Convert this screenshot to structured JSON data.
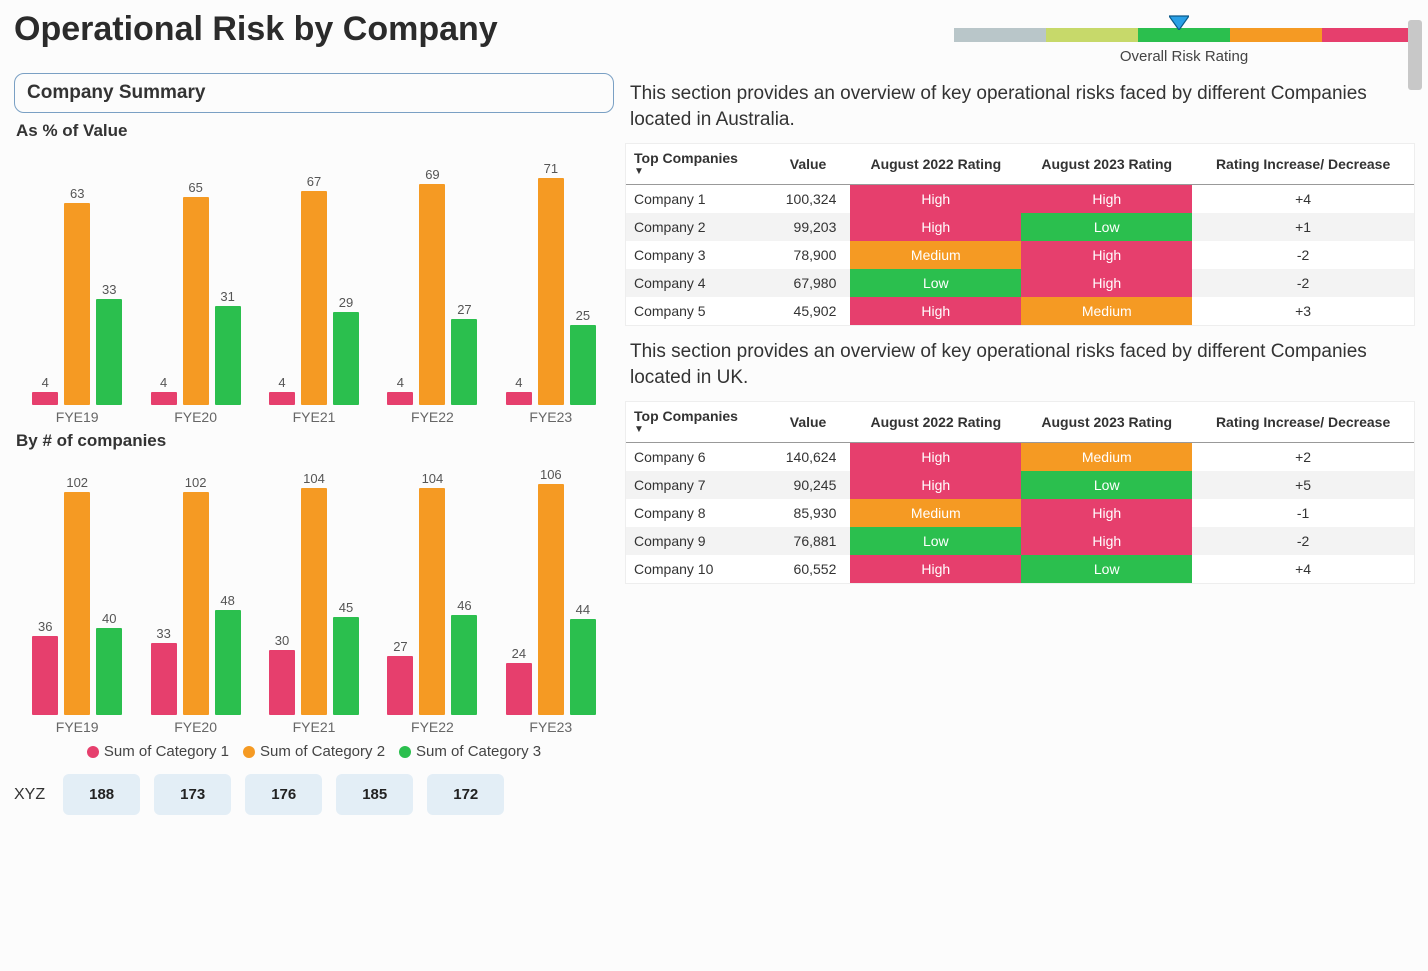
{
  "title": "Operational Risk by Company",
  "gauge": {
    "label": "Overall Risk Rating",
    "pointer_pct": 49,
    "segments": [
      "#b9c6c9",
      "#c7d96a",
      "#2bbf4e",
      "#f59a23",
      "#e63f6d"
    ]
  },
  "summary_box": "Company Summary",
  "chart1_title": "As % of Value",
  "chart2_title": "By # of companies",
  "legend": [
    "Sum of Category 1",
    "Sum of Category 2",
    "Sum of Category 3"
  ],
  "colors": {
    "c1": "#e63f6d",
    "c2": "#f59a23",
    "c3": "#2bbf4e"
  },
  "chart_data": [
    {
      "type": "bar",
      "title": "As % of Value",
      "categories": [
        "FYE19",
        "FYE20",
        "FYE21",
        "FYE22",
        "FYE23"
      ],
      "series": [
        {
          "name": "Sum of Category 1",
          "values": [
            4,
            4,
            4,
            4,
            4
          ]
        },
        {
          "name": "Sum of Category 2",
          "values": [
            63,
            65,
            67,
            69,
            71
          ]
        },
        {
          "name": "Sum of Category 3",
          "values": [
            33,
            31,
            29,
            27,
            25
          ]
        }
      ],
      "ylim": [
        0,
        75
      ]
    },
    {
      "type": "bar",
      "title": "By # of companies",
      "categories": [
        "FYE19",
        "FYE20",
        "FYE21",
        "FYE22",
        "FYE23"
      ],
      "series": [
        {
          "name": "Sum of Category 1",
          "values": [
            36,
            33,
            30,
            27,
            24
          ]
        },
        {
          "name": "Sum of Category 2",
          "values": [
            102,
            102,
            104,
            104,
            106
          ]
        },
        {
          "name": "Sum of Category 3",
          "values": [
            40,
            48,
            45,
            46,
            44
          ]
        }
      ],
      "ylim": [
        0,
        110
      ]
    }
  ],
  "section1_desc": "This section provides an overview of key operational risks faced by different Companies located in Australia.",
  "section2_desc": "This section provides an overview of key operational risks faced by different Companies located in UK.",
  "table_headers": {
    "company": "Top Companies",
    "value": "Value",
    "r22": "August 2022 Rating",
    "r23": "August 2023 Rating",
    "change": "Rating Increase/ Decrease"
  },
  "table1": [
    {
      "name": "Company 1",
      "value": "100,324",
      "r22": "High",
      "r23": "High",
      "change": "+4"
    },
    {
      "name": "Company 2",
      "value": "99,203",
      "r22": "High",
      "r23": "Low",
      "change": "+1"
    },
    {
      "name": "Company 3",
      "value": "78,900",
      "r22": "Medium",
      "r23": "High",
      "change": "-2"
    },
    {
      "name": "Company 4",
      "value": "67,980",
      "r22": "Low",
      "r23": "High",
      "change": "-2"
    },
    {
      "name": "Company 5",
      "value": "45,902",
      "r22": "High",
      "r23": "Medium",
      "change": "+3"
    }
  ],
  "table2": [
    {
      "name": "Company 6",
      "value": "140,624",
      "r22": "High",
      "r23": "Medium",
      "change": "+2"
    },
    {
      "name": "Company 7",
      "value": "90,245",
      "r22": "High",
      "r23": "Low",
      "change": "+5"
    },
    {
      "name": "Company 8",
      "value": "85,930",
      "r22": "Medium",
      "r23": "High",
      "change": "-1"
    },
    {
      "name": "Company 9",
      "value": "76,881",
      "r22": "Low",
      "r23": "High",
      "change": "-2"
    },
    {
      "name": "Company 10",
      "value": "60,552",
      "r22": "High",
      "r23": "Low",
      "change": "+4"
    }
  ],
  "xyz": {
    "label": "XYZ",
    "values": [
      "188",
      "173",
      "176",
      "185",
      "172"
    ]
  }
}
